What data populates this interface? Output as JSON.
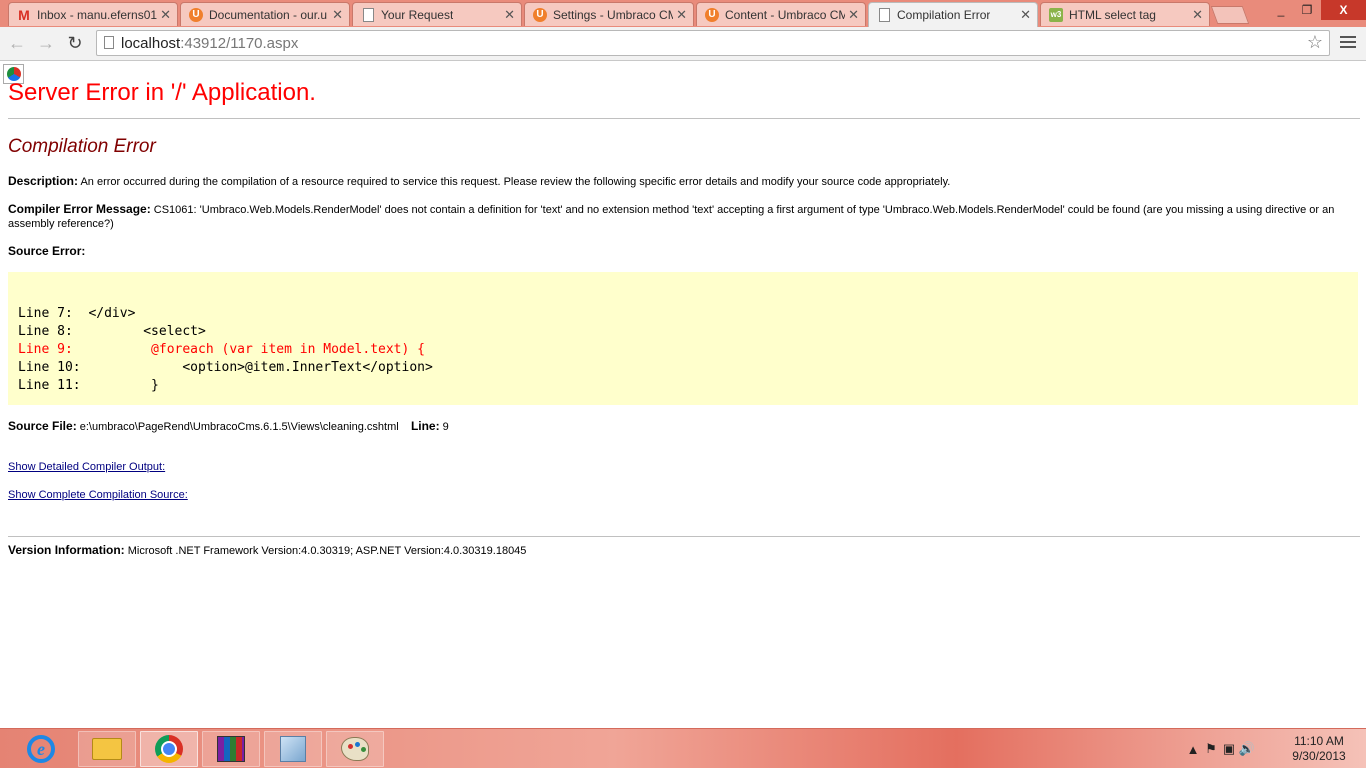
{
  "browser": {
    "tabs": [
      {
        "title": "Inbox - manu.eferns01",
        "icon": "gmail-icon",
        "active": false
      },
      {
        "title": "Documentation - our.u",
        "icon": "umbraco-icon",
        "active": false
      },
      {
        "title": "Your Request",
        "icon": "document-icon",
        "active": false
      },
      {
        "title": "Settings - Umbraco CM",
        "icon": "umbraco-icon",
        "active": false
      },
      {
        "title": "Content - Umbraco CM",
        "icon": "umbraco-icon",
        "active": false
      },
      {
        "title": "Compilation Error",
        "icon": "document-icon",
        "active": true
      },
      {
        "title": "HTML select tag",
        "icon": "w3schools-icon",
        "active": false
      }
    ],
    "address": {
      "host": "localhost",
      "path": ":43912/1170.aspx"
    },
    "window_controls": {
      "minimize": "_",
      "maximize": "❐",
      "close": "X"
    }
  },
  "page": {
    "title": "Server Error in '/' Application.",
    "subtitle": "Compilation Error",
    "description": {
      "label": "Description:",
      "text": "An error occurred during the compilation of a resource required to service this request. Please review the following specific error details and modify your source code appropriately."
    },
    "compiler_error": {
      "label": "Compiler Error Message:",
      "text": "CS1061: 'Umbraco.Web.Models.RenderModel' does not contain a definition for 'text' and no extension method 'text' accepting a first argument of type 'Umbraco.Web.Models.RenderModel' could be found (are you missing a using directive or an assembly reference?)"
    },
    "source_error_label": "Source Error:",
    "code_lines": [
      {
        "text": "Line 7:  </div>",
        "error": false
      },
      {
        "text": "Line 8:         <select>",
        "error": false
      },
      {
        "text": "Line 9:          @foreach (var item in Model.text) {",
        "error": true
      },
      {
        "text": "Line 10:             <option>@item.InnerText</option>",
        "error": false
      },
      {
        "text": "Line 11:         }",
        "error": false
      }
    ],
    "source_file": {
      "label": "Source File:",
      "path": "e:\\umbraco\\PageRend\\UmbracoCms.6.1.5\\Views\\cleaning.cshtml",
      "line_label": "Line:",
      "line": "9"
    },
    "links": {
      "detailed_output": "Show Detailed Compiler Output:",
      "complete_source": "Show Complete Compilation Source:"
    },
    "version": {
      "label": "Version Information:",
      "text": "Microsoft .NET Framework Version:4.0.30319; ASP.NET Version:4.0.30319.18045"
    }
  },
  "taskbar": {
    "apps": [
      {
        "name": "internet-explorer-icon",
        "state": "pinned"
      },
      {
        "name": "file-explorer-icon",
        "state": "pinned"
      },
      {
        "name": "chrome-icon",
        "state": "running"
      },
      {
        "name": "winrar-icon",
        "state": "pinned"
      },
      {
        "name": "virtualbox-icon",
        "state": "pinned"
      },
      {
        "name": "paint-icon",
        "state": "pinned"
      }
    ],
    "clock": {
      "time": "11:10 AM",
      "date": "9/30/2013"
    }
  }
}
